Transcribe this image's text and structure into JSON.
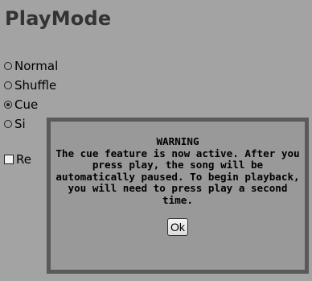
{
  "page": {
    "title": "PlayMode"
  },
  "play_modes": [
    {
      "label": "Normal",
      "checked": false
    },
    {
      "label": "Shuffle",
      "checked": false
    },
    {
      "label": "Cue",
      "checked": true
    },
    {
      "label": "Si",
      "checked": false
    }
  ],
  "repeat": {
    "label": "Re",
    "checked": false
  },
  "dialog": {
    "heading": "WARNING",
    "message": "The cue feature is now active. After you press play, the song will be automatically paused. To begin playback, you will need to press play a second time.",
    "ok_label": "Ok"
  },
  "colors": {
    "background": "#a3a3a3",
    "dialog_background": "#999999",
    "dialog_border": "#5a5a5a",
    "title_text": "#333333"
  }
}
